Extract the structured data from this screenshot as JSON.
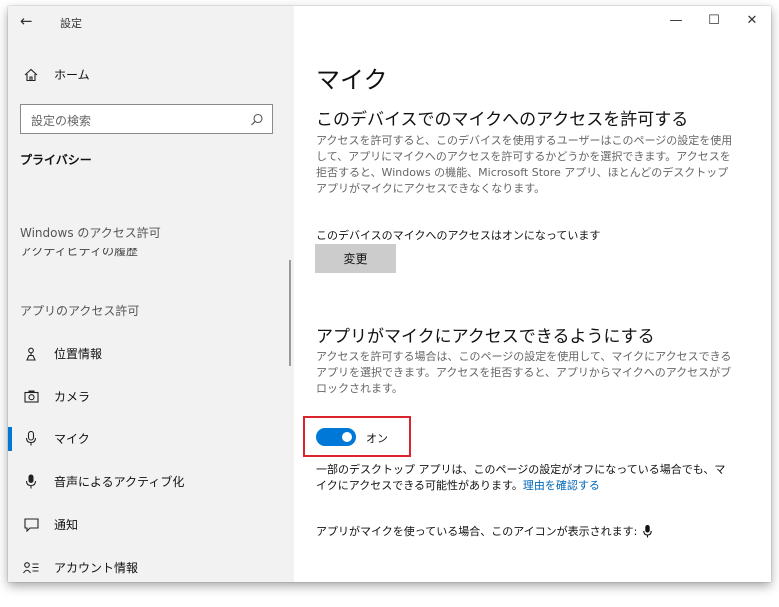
{
  "titlebar": {
    "back_icon": "back-arrow-icon",
    "title": "設定",
    "minimize_glyph": "—",
    "maximize_glyph": "☐",
    "close_glyph": "✕"
  },
  "sidebar": {
    "home_label": "ホーム",
    "search_placeholder": "設定の検索",
    "category_title": "プライバシー",
    "section_windows": "Windows のアクセス許可",
    "clipped_item_label": "アクティビティの履歴",
    "section_apps": "アプリのアクセス許可",
    "items": [
      {
        "label": "位置情報",
        "icon": "location-icon"
      },
      {
        "label": "カメラ",
        "icon": "camera-icon"
      },
      {
        "label": "マイク",
        "icon": "microphone-icon",
        "active": true
      },
      {
        "label": "音声によるアクティブ化",
        "icon": "voice-activation-icon"
      },
      {
        "label": "通知",
        "icon": "notification-icon"
      },
      {
        "label": "アカウント情報",
        "icon": "account-info-icon"
      }
    ]
  },
  "main": {
    "page_title": "マイク",
    "device_section": {
      "heading": "このデバイスでのマイクへのアクセスを許可する",
      "description": "アクセスを許可すると、このデバイスを使用するユーザーはこのページの設定を使用して、アプリにマイクへのアクセスを許可するかどうかを選択できます。アクセスを拒否すると、Windows の機能、Microsoft Store アプリ、ほとんどのデスクトップ アプリがマイクにアクセスできなくなります。",
      "status": "このデバイスのマイクへのアクセスはオンになっています",
      "change_button": "変更"
    },
    "apps_section": {
      "heading": "アプリがマイクにアクセスできるようにする",
      "description": "アクセスを許可する場合は、このページの設定を使用して、マイクにアクセスできるアプリを選択できます。アクセスを拒否すると、アプリからマイクへのアクセスがブロックされます。",
      "toggle_label": "オン",
      "toggle_on": true,
      "note_text": "一部のデスクトップ アプリは、このページの設定がオフになっている場合でも、マイクにアクセスできる可能性があります。",
      "note_link": "理由を確認する",
      "indicator_text": "アプリがマイクを使っている場合、このアイコンが表示されます:"
    }
  },
  "colors": {
    "accent": "#0078d7",
    "highlight_border": "#d9252b",
    "link": "#0067b8"
  }
}
